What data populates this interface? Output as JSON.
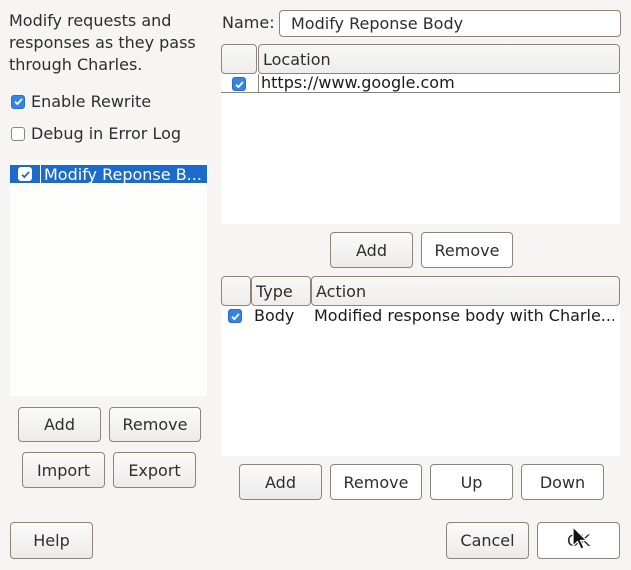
{
  "sidebar": {
    "description": "Modify requests and responses as they pass through Charles.",
    "enable_rewrite": {
      "label": "Enable Rewrite",
      "checked": true
    },
    "debug_log": {
      "label": "Debug in Error Log",
      "checked": false
    },
    "rules": [
      {
        "label": "Modify Reponse B...",
        "checked": true,
        "selected": true
      }
    ],
    "buttons": {
      "add": "Add",
      "remove": "Remove",
      "import": "Import",
      "export": "Export"
    }
  },
  "rule": {
    "name_label": "Name:",
    "name_value": "Modify Reponse Body",
    "locations": {
      "header": "Location",
      "rows": [
        {
          "checked": true,
          "location": "https://www.google.com"
        }
      ],
      "buttons": {
        "add": "Add",
        "remove": "Remove"
      }
    },
    "actions": {
      "headers": {
        "type": "Type",
        "action": "Action"
      },
      "rows": [
        {
          "checked": true,
          "type": "Body",
          "action": "Modified response body with Charle..."
        }
      ],
      "buttons": {
        "add": "Add",
        "remove": "Remove",
        "up": "Up",
        "down": "Down"
      }
    }
  },
  "footer": {
    "help": "Help",
    "cancel": "Cancel",
    "ok": "OK"
  },
  "colors": {
    "accent": "#3584e4",
    "selection": "#1c6ac9",
    "border": "#8d857b",
    "background": "#f6f5f4"
  }
}
